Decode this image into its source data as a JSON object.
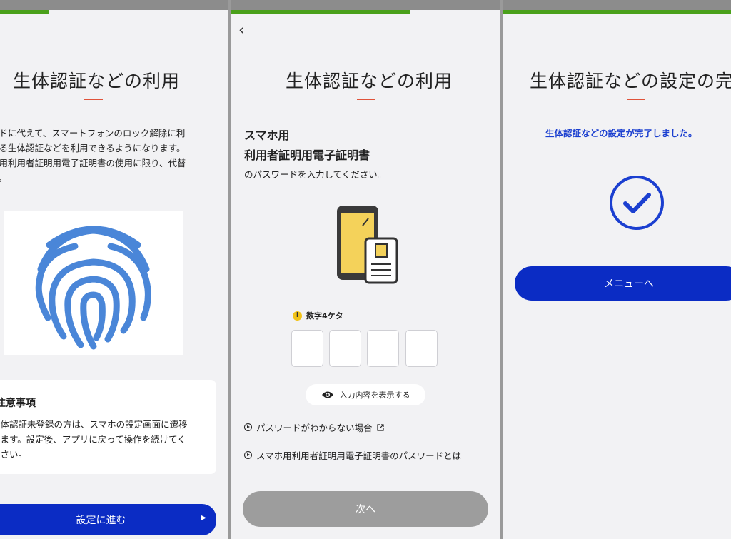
{
  "screen1": {
    "title": "生体認証などの利用",
    "desc": [
      "ードに代えて、スマートフォンのロック解除に利",
      "いる生体認証などを利用できるようになります。",
      "ホ用利用者証明用電子証明書の使用に限り、代替",
      "す。"
    ],
    "notice_title": "注意事項",
    "notice_body": [
      "生体認証未登録の方は、スマホの設定画面に遷移",
      "します。設定後、アプリに戻って操作を続けてく",
      "ださい。"
    ],
    "button": "設定に進む",
    "button_arrow": "▶"
  },
  "screen2": {
    "back": "‹",
    "title": "生体認証などの利用",
    "sub1": "スマホ用",
    "sub2": "利用者証明用電子証明書",
    "sub3": "のパスワードを入力してください。",
    "hint_icon": "i",
    "hint": "数字4ケタ",
    "show_input": "入力内容を表示する",
    "link1": "パスワードがわからない場合",
    "link2": "スマホ用利用者証明用電子証明書のパスワードとは",
    "next": "次へ"
  },
  "screen3": {
    "title": "生体認証などの設定の完了",
    "message": "生体認証などの設定が完了しました。",
    "button": "メニューへ"
  },
  "colors": {
    "primary": "#0b2cc4",
    "accent_rule": "#e0533a",
    "progress": "#4aa01a",
    "disabled": "#9d9d9d"
  },
  "icons": [
    "fingerprint-icon",
    "phone-certificate-icon",
    "info-icon",
    "eye-icon",
    "play-circle-icon",
    "external-link-icon",
    "check-circle-icon",
    "back-chevron-icon"
  ]
}
